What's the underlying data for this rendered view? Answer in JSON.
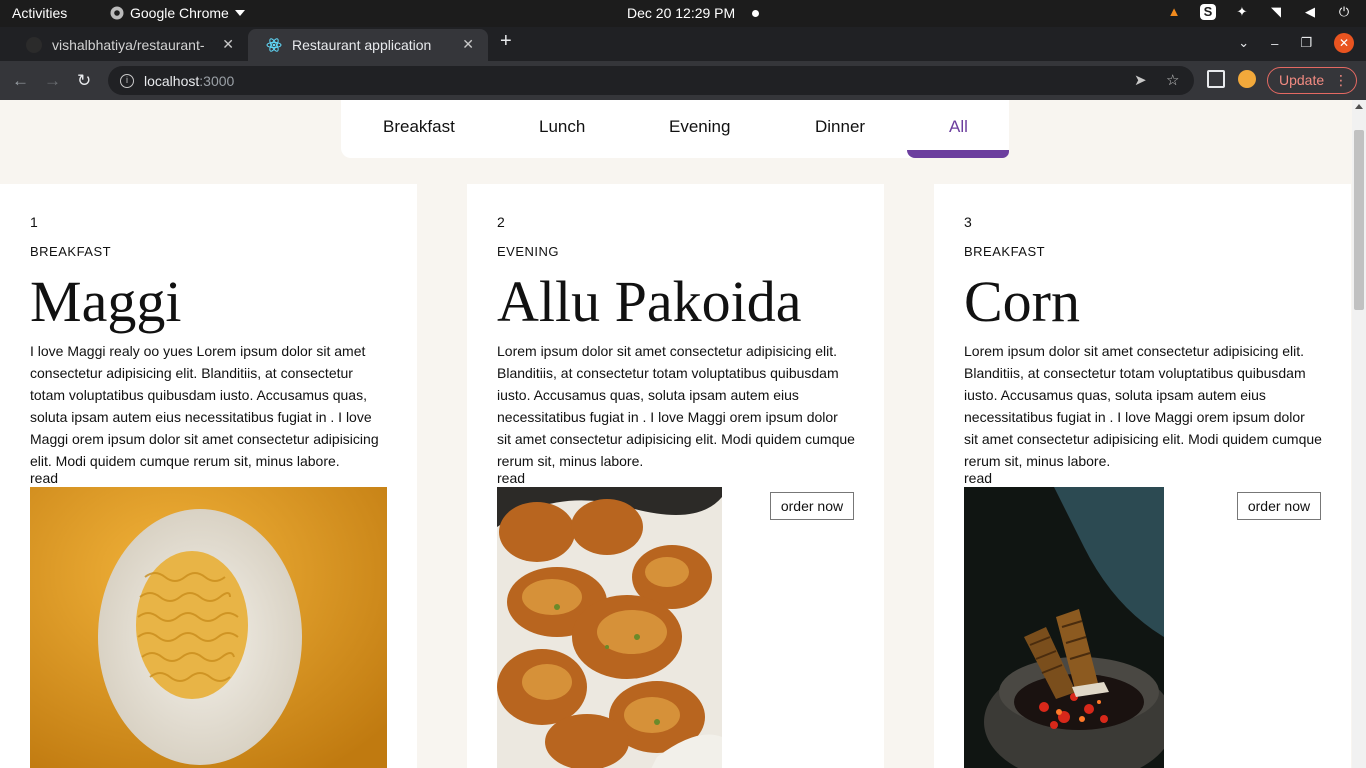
{
  "system": {
    "activities": "Activities",
    "app_name": "Google Chrome",
    "clock": "Dec 20  12:29 PM"
  },
  "browser": {
    "tabs": [
      {
        "label": "vishalbhatiya/restaurant-"
      },
      {
        "label": "Restaurant application"
      }
    ],
    "url_host": "localhost",
    "url_port": ":3000",
    "update_label": "Update"
  },
  "menu": {
    "items": [
      "Breakfast",
      "Lunch",
      "Evening",
      "Dinner",
      "All"
    ],
    "active": "All",
    "accent_color": "#6c3e9e"
  },
  "cards": [
    {
      "id": "1",
      "category": "BREAKFAST",
      "name": "Maggi",
      "description": "I love Maggi realy oo yues Lorem ipsum dolor sit amet consectetur adipisicing elit. Blanditiis, at consectetur totam voluptatibus quibusdam iusto. Accusamus quas, soluta ipsam autem eius necessitatibus fugiat in . I love Maggi orem ipsum dolor sit amet consectetur adipisicing elit. Modi quidem cumque rerum sit, minus labore.",
      "read_label": "read",
      "image": "maggi-noodles-plate"
    },
    {
      "id": "2",
      "category": "EVENING",
      "name": "Allu Pakoida",
      "description": "Lorem ipsum dolor sit amet consectetur adipisicing elit. Blanditiis, at consectetur totam voluptatibus quibusdam iusto. Accusamus quas, soluta ipsam autem eius necessitatibus fugiat in . I love Maggi orem ipsum dolor sit amet consectetur adipisicing elit. Modi quidem cumque rerum sit, minus labore.",
      "read_label": "read",
      "order_label": "order now",
      "image": "pakoda-basket"
    },
    {
      "id": "3",
      "category": "BREAKFAST",
      "name": "Corn",
      "description": "Lorem ipsum dolor sit amet consectetur adipisicing elit. Blanditiis, at consectetur totam voluptatibus quibusdam iusto. Accusamus quas, soluta ipsam autem eius necessitatibus fugiat in . I love Maggi orem ipsum dolor sit amet consectetur adipisicing elit. Modi quidem cumque rerum sit, minus labore.",
      "read_label": "read",
      "order_label": "order now",
      "image": "roasted-corn-coals"
    }
  ]
}
